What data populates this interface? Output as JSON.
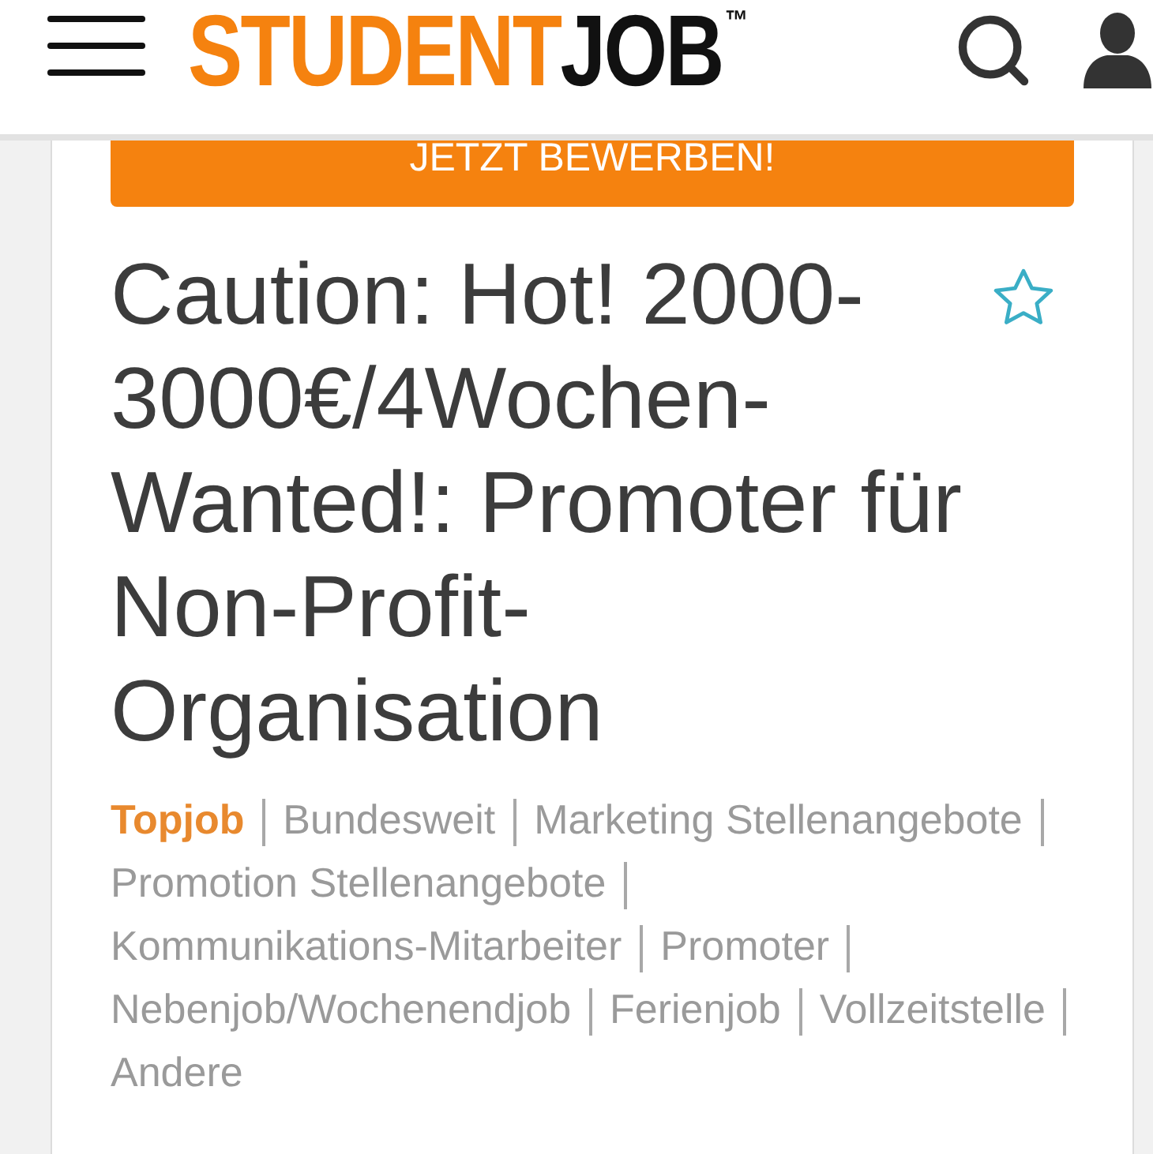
{
  "header": {
    "logo": {
      "parts": [
        {
          "text": "STUDENT",
          "color": "#f5820f"
        },
        {
          "text": "JOB",
          "color": "#111111"
        }
      ],
      "trademark": "™"
    }
  },
  "job": {
    "apply_button": "JETZT BEWERBEN!",
    "title": "Caution: Hot! 2000-3000€/4Wochen-Wanted!: Promoter für Non-Profit-Organisation",
    "favorite": false,
    "tags": [
      {
        "label": "Topjob",
        "highlighted": true
      },
      {
        "label": "Bundesweit",
        "highlighted": false
      },
      {
        "label": "Marketing Stellenangebote",
        "highlighted": false
      },
      {
        "label": "Promotion Stellenangebote",
        "highlighted": false
      },
      {
        "label": "Kommunikations-Mitarbeiter",
        "highlighted": false
      },
      {
        "label": "Promoter",
        "highlighted": false
      },
      {
        "label": "Nebenjob/Wochenendjob",
        "highlighted": false
      },
      {
        "label": "Ferienjob",
        "highlighted": false
      },
      {
        "label": "Vollzeitstelle",
        "highlighted": false
      },
      {
        "label": "Andere",
        "highlighted": false
      }
    ]
  }
}
